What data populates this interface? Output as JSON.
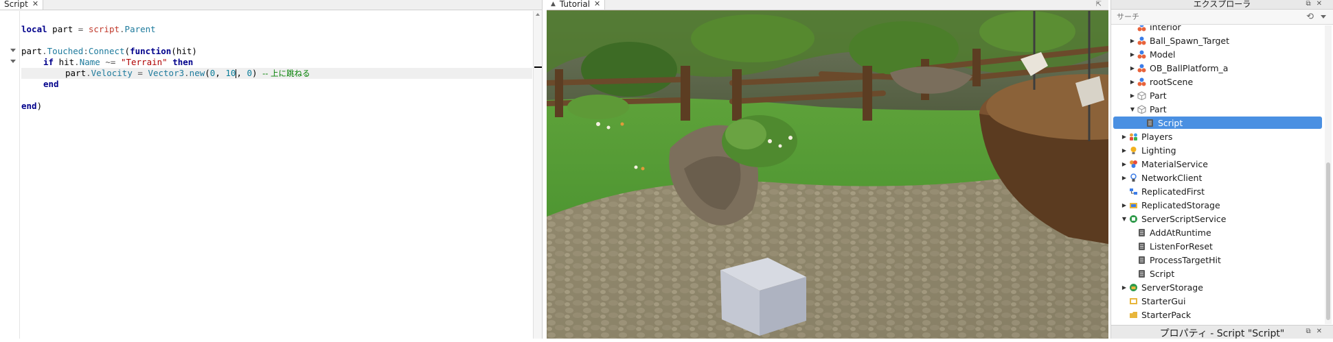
{
  "editor": {
    "tab_label": "Script",
    "tab_close": "✕",
    "lines": {
      "l1": {
        "kw1": "local",
        "t1": " part ",
        "op1": "=",
        "t2": " ",
        "p1": "script",
        "op2": ".",
        "p2": "Parent"
      },
      "l2": {
        "t1": "part",
        "op1": ".",
        "p1": "Touched",
        "op2": ":",
        "p2": "Connect",
        "t2": "(",
        "kw1": "function",
        "t3": "(hit)"
      },
      "l3": {
        "kw1": "if",
        "t1": " hit",
        "op1": ".",
        "p1": "Name",
        "t2": " ",
        "op2": "~=",
        "t3": " ",
        "s1": "\"Terrain\"",
        "t4": " ",
        "kw2": "then"
      },
      "l4": {
        "t1": "part",
        "op1": ".",
        "p1": "Velocity",
        "t2": " ",
        "op2": "=",
        "t3": " ",
        "p2": "Vector3",
        "op3": ".",
        "p3": "new",
        "t4": "(",
        "n1": "0",
        "t5": ", ",
        "n2": "10",
        "t6": ", ",
        "n3": "0",
        "t7": ")",
        "t8": " ",
        "c1": "-- 上に跳ねる"
      },
      "l5": {
        "kw1": "end"
      },
      "l6": {
        "kw1": "end",
        "t1": ")"
      }
    }
  },
  "viewport": {
    "tab_label": "Tutorial",
    "tab_close": "✕",
    "corner_icon": "⇱"
  },
  "explorer": {
    "title": "エクスプローラ",
    "search_placeholder": "サーチ",
    "items": [
      {
        "label": "Interior",
        "arrow": "",
        "icon": "model-icon",
        "depth": 2
      },
      {
        "label": "Ball_Spawn_Target",
        "arrow": "▶",
        "icon": "model-icon",
        "depth": 2
      },
      {
        "label": "Model",
        "arrow": "▶",
        "icon": "model-icon",
        "depth": 2
      },
      {
        "label": "OB_BallPlatform_a",
        "arrow": "▶",
        "icon": "model-icon",
        "depth": 2
      },
      {
        "label": "rootScene",
        "arrow": "▶",
        "icon": "model-icon",
        "depth": 2
      },
      {
        "label": "Part",
        "arrow": "▶",
        "icon": "part-icon",
        "depth": 2
      },
      {
        "label": "Part",
        "arrow": "▼",
        "icon": "part-icon",
        "depth": 2
      },
      {
        "label": "Script",
        "arrow": "",
        "icon": "script-icon",
        "depth": 3,
        "selected": true
      },
      {
        "label": "Players",
        "arrow": "▶",
        "icon": "players-icon",
        "depth": 1
      },
      {
        "label": "Lighting",
        "arrow": "▶",
        "icon": "lighting-icon",
        "depth": 1
      },
      {
        "label": "MaterialService",
        "arrow": "▶",
        "icon": "material-service-icon",
        "depth": 1
      },
      {
        "label": "NetworkClient",
        "arrow": "▶",
        "icon": "network-client-icon",
        "depth": 1
      },
      {
        "label": "ReplicatedFirst",
        "arrow": "",
        "icon": "replicated-first-icon",
        "depth": 1
      },
      {
        "label": "ReplicatedStorage",
        "arrow": "▶",
        "icon": "replicated-storage-icon",
        "depth": 1
      },
      {
        "label": "ServerScriptService",
        "arrow": "▼",
        "icon": "server-script-service-icon",
        "depth": 1
      },
      {
        "label": "AddAtRuntime",
        "arrow": "",
        "icon": "script-icon",
        "depth": 2
      },
      {
        "label": "ListenForReset",
        "arrow": "",
        "icon": "script-icon",
        "depth": 2
      },
      {
        "label": "ProcessTargetHit",
        "arrow": "",
        "icon": "script-icon",
        "depth": 2
      },
      {
        "label": "Script",
        "arrow": "",
        "icon": "script-icon",
        "depth": 2
      },
      {
        "label": "ServerStorage",
        "arrow": "▶",
        "icon": "server-storage-icon",
        "depth": 1
      },
      {
        "label": "StarterGui",
        "arrow": "",
        "icon": "starter-gui-icon",
        "depth": 1
      },
      {
        "label": "StarterPack",
        "arrow": "",
        "icon": "starter-pack-icon",
        "depth": 1
      }
    ]
  },
  "properties": {
    "title": "プロパティ - Script \"Script\""
  },
  "colors": {
    "selection": "#4a90e2",
    "keyword": "#00008b",
    "property": "#1d7a9c",
    "string": "#b00000",
    "comment": "#007f00"
  }
}
